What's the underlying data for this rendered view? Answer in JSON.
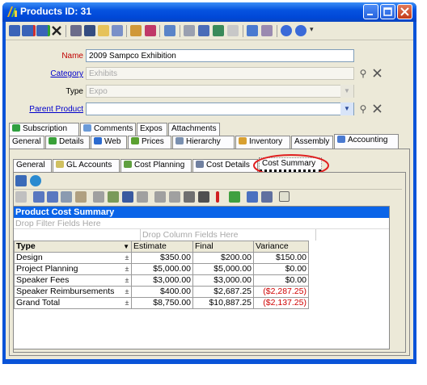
{
  "window": {
    "title": "Products ID: 31"
  },
  "toolbar": {
    "icons": [
      "save-icon",
      "save-close-icon",
      "save-new-icon",
      "delete-icon",
      "print-icon",
      "find-icon",
      "folder-icon",
      "list-icon",
      "edit-icon",
      "tools-icon",
      "copy-icon",
      "merge-icon",
      "refresh-icon",
      "search-icon",
      "link-icon",
      "eraser-icon",
      "help-icon",
      "info-icon"
    ]
  },
  "form": {
    "name_label": "Name",
    "name_value": "2009 Sampco Exhibition",
    "category_label": "Category",
    "category_value": "Exhibits",
    "type_label": "Type",
    "type_value": "Expo",
    "parent_label": "Parent Product",
    "parent_value": ""
  },
  "tabs_row1": [
    "Subscription",
    "Comments",
    "Expos",
    "Attachments"
  ],
  "tabs_row2": [
    "General",
    "Details",
    "Web",
    "Prices",
    "Hierarchy",
    "Inventory",
    "Assembly",
    "Accounting"
  ],
  "subtabs": [
    "General",
    "GL Accounts",
    "Cost Planning",
    "Cost Details",
    "Cost Summary"
  ],
  "pivot": {
    "title": "Product Cost Summary",
    "drop_filter": "Drop Filter Fields Here",
    "drop_column": "Drop Column Fields Here",
    "row_header": "Type",
    "columns": [
      "Estimate",
      "Final",
      "Variance"
    ],
    "rows": [
      {
        "type": "Design",
        "estimate": "$350.00",
        "final": "$200.00",
        "variance": "$150.00",
        "neg": false
      },
      {
        "type": "Project Planning",
        "estimate": "$5,000.00",
        "final": "$5,000.00",
        "variance": "$0.00",
        "neg": false
      },
      {
        "type": "Speaker Fees",
        "estimate": "$3,000.00",
        "final": "$3,000.00",
        "variance": "$0.00",
        "neg": false
      },
      {
        "type": "Speaker Reimbursements",
        "estimate": "$400.00",
        "final": "$2,687.25",
        "variance": "($2,287.25)",
        "neg": true
      },
      {
        "type": "Grand Total",
        "estimate": "$8,750.00",
        "final": "$10,887.25",
        "variance": "($2,137.25)",
        "neg": true
      }
    ]
  },
  "colors": {
    "title_bar": "#0a53d8",
    "pivot_header": "#0a64e8",
    "negative": "#d00000",
    "highlight_circle": "#e02020"
  }
}
